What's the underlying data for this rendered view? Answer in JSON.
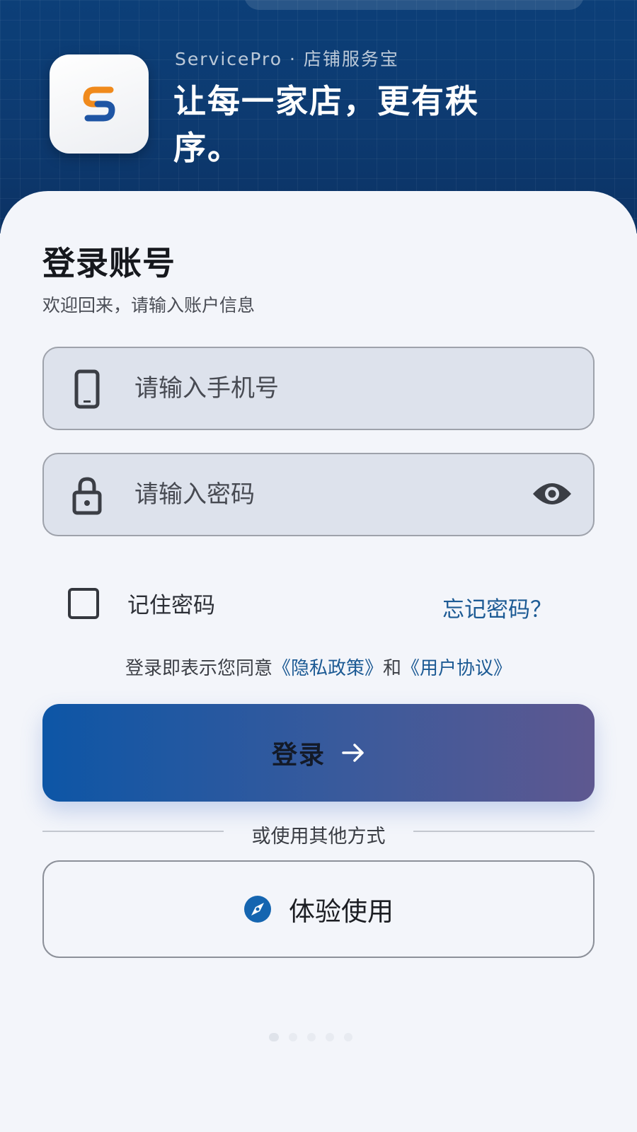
{
  "header": {
    "brand_line": "ServicePro · 店铺服务宝",
    "slogan": "让每一家店，更有秩序。"
  },
  "login": {
    "title": "登录账号",
    "subtitle": "欢迎回来，请输入账户信息",
    "phone_placeholder": "请输入手机号",
    "password_placeholder": "请输入密码",
    "remember_label": "记住密码",
    "remember_checked": false,
    "forgot_label": "忘记密码？",
    "agreement": {
      "prefix": "登录即表示您同意",
      "privacy": "《隐私政策》",
      "and": "和",
      "terms": "《用户协议》"
    },
    "login_button": "登录",
    "divider_text": "或使用其他方式",
    "trial_button": "体验使用"
  },
  "colors": {
    "hero_bg": "#0c3f78",
    "accent_link": "#1c5a94",
    "button_gradient_start": "#0d56a6",
    "button_gradient_end": "#5e5890",
    "logo_orange": "#f08a1c",
    "logo_blue": "#1e55a4"
  },
  "icons": {
    "app": "servicepro-logo-icon",
    "phone": "phone-icon",
    "lock": "lock-icon",
    "eye": "eye-icon",
    "arrow": "arrow-right-icon",
    "compass": "compass-icon"
  }
}
